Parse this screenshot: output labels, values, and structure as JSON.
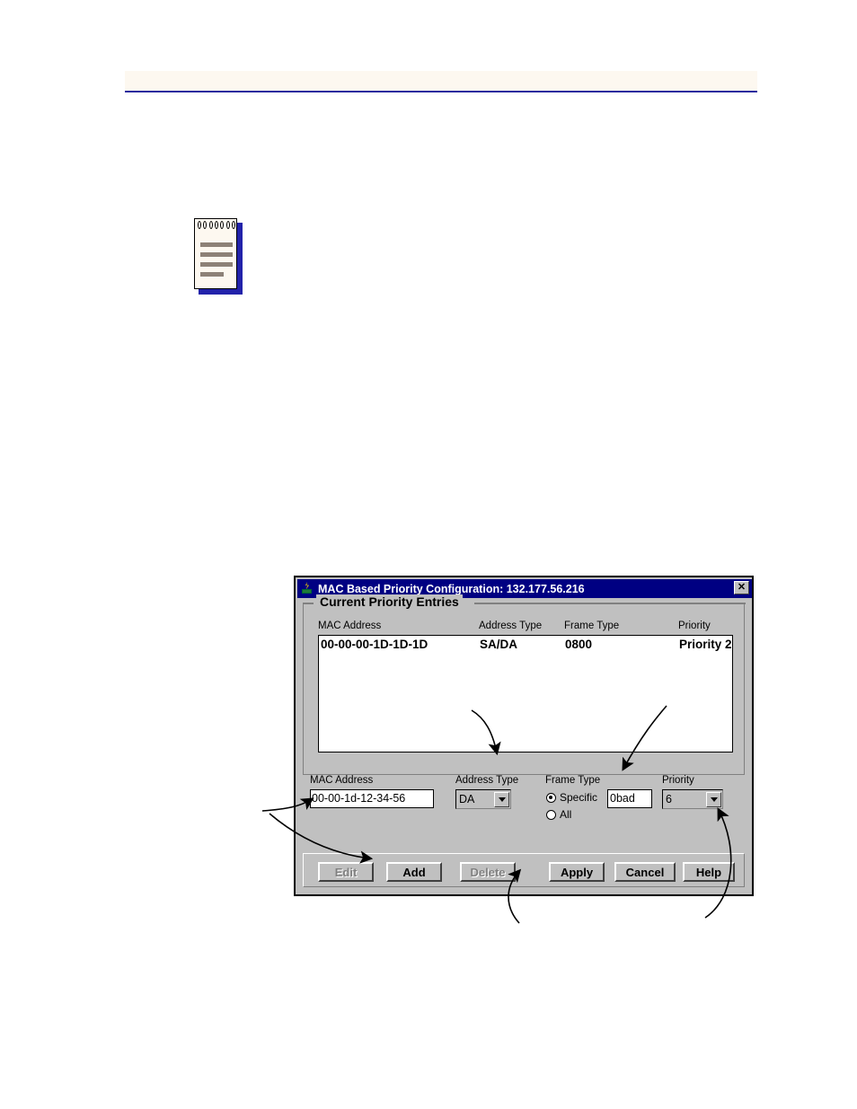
{
  "page": {
    "header_band_color": "#fdf8f0",
    "header_rule_color": "#2b2b9e"
  },
  "note_icon": {
    "name": "note-icon",
    "line_count": 4
  },
  "dialog": {
    "title": "MAC Based Priority Configuration: 132.177.56.216",
    "title_icon": "java-cup-icon",
    "close_label": "✕",
    "titlebar_color": "#000082",
    "face_color": "#c0c0c0",
    "group": {
      "title": "Current Priority Entries",
      "columns": [
        "MAC Address",
        "Address Type",
        "Frame Type",
        "Priority"
      ],
      "rows": [
        {
          "mac_address": "00-00-00-1D-1D-1D",
          "address_type": "SA/DA",
          "frame_type": "0800",
          "priority": "Priority 2"
        }
      ]
    },
    "form": {
      "mac_address_label": "MAC Address",
      "mac_address_value": "00-00-1d-12-34-56",
      "address_type_label": "Address Type",
      "address_type_value": "DA",
      "frame_type_label": "Frame Type",
      "frame_type_specific_label": "Specific",
      "frame_type_specific_value": "0bad",
      "frame_type_all_label": "All",
      "frame_type_selected": "Specific",
      "priority_label": "Priority",
      "priority_value": "6"
    },
    "buttons": [
      {
        "label": "Edit",
        "enabled": false
      },
      {
        "label": "Add",
        "enabled": true
      },
      {
        "label": "Delete",
        "enabled": false
      },
      {
        "label": "Apply",
        "enabled": true
      },
      {
        "label": "Cancel",
        "enabled": true
      },
      {
        "label": "Help",
        "enabled": true
      }
    ]
  }
}
